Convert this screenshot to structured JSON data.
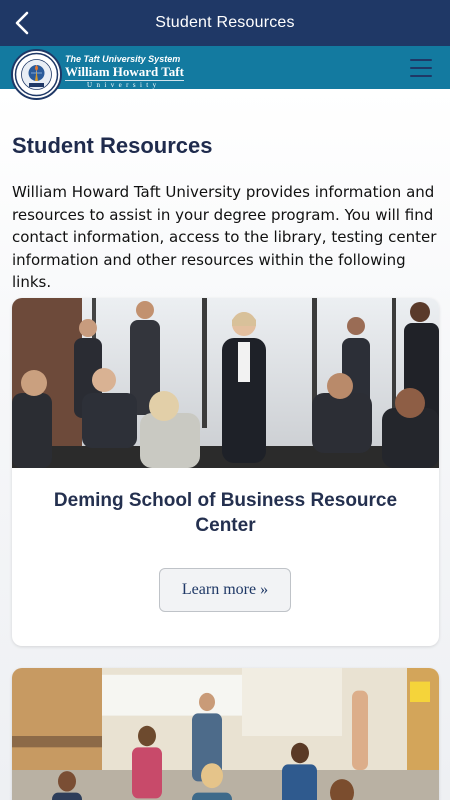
{
  "appbar": {
    "title": "Student Resources"
  },
  "site": {
    "system_label": "The Taft University System",
    "university_name": "William Howard Taft",
    "university_word": "University",
    "seal_text": "EST. 1976"
  },
  "page": {
    "heading": "Student Resources",
    "intro": "William Howard Taft University provides information and resources to assist in your degree program. You will find contact information, access to the library, testing center information and other resources within the following links."
  },
  "cards": [
    {
      "title": "Deming School of Business Resource Center",
      "button": "Learn more »"
    }
  ],
  "colors": {
    "appbar": "#1f3866",
    "site_header": "#137aa0",
    "heading": "#1f2b4d"
  }
}
